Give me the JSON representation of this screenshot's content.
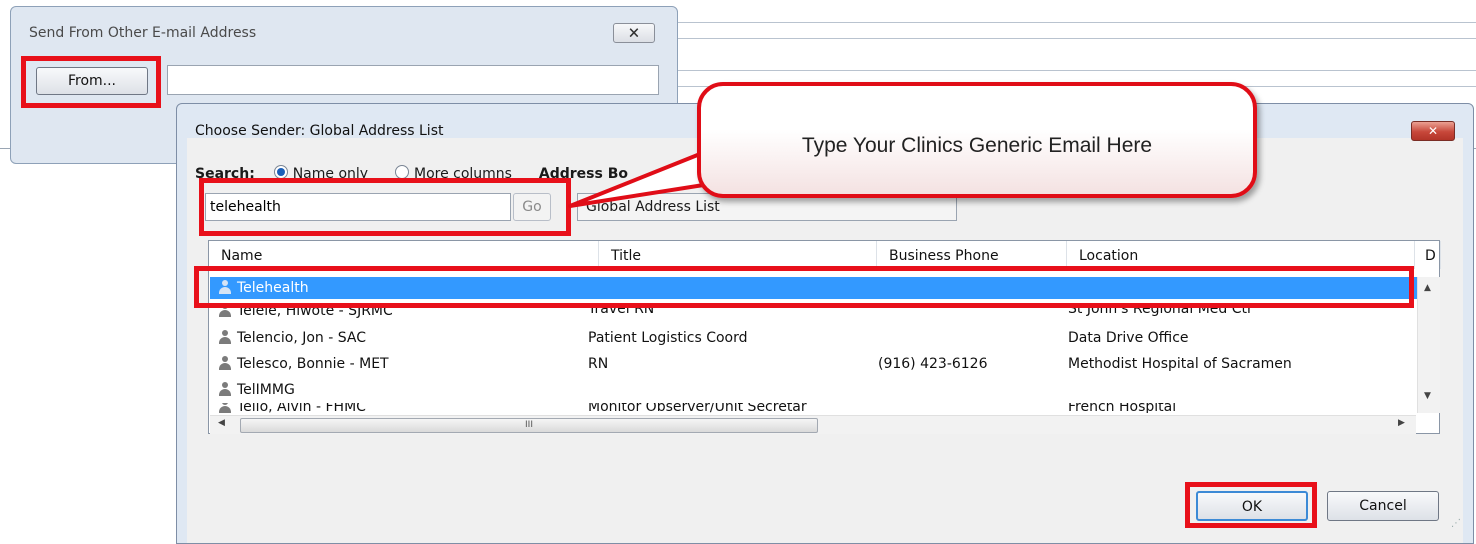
{
  "dialog_from": {
    "title": "Send From Other E-mail Address",
    "close_label": "🗙",
    "from_button": "From...",
    "from_value": ""
  },
  "dialog_choose": {
    "title": "Choose Sender: Global Address List",
    "close_label": "✕",
    "search_label": "Search:",
    "option_name_only": "Name only",
    "option_more_columns": "More columns",
    "address_book_label": "Address Bo",
    "search_value": "telehealth",
    "go_button": "Go",
    "address_book_value": "Global Address List",
    "columns": [
      "Name",
      "Title",
      "Business Phone",
      "Location",
      "D"
    ],
    "rows": [
      {
        "name": "Telehealth",
        "title": "",
        "phone": "",
        "location": "",
        "selected": true
      },
      {
        "name": "Telele, Hiwote - SJRMC",
        "title": "Travel RN",
        "phone": "",
        "location": "St John's Regional Med Ctr"
      },
      {
        "name": "Telencio, Jon - SAC",
        "title": "Patient Logistics Coord",
        "phone": "",
        "location": "Data Drive Office"
      },
      {
        "name": "Telesco, Bonnie - MET",
        "title": "RN",
        "phone": "(916) 423-6126",
        "location": "Methodist Hospital of Sacramen"
      },
      {
        "name": "TelIMMG",
        "title": "",
        "phone": "",
        "location": ""
      },
      {
        "name": "Tello, Alvin - FHMC",
        "title": "Monitor Observer/Unit Secretar",
        "phone": "",
        "location": "French Hospital"
      }
    ],
    "hscroll_grip": "III",
    "ok_button": "OK",
    "cancel_button": "Cancel"
  },
  "callout": {
    "text": "Type Your Clinics Generic Email Here"
  },
  "colors": {
    "highlight_red": "#e8101a",
    "selection_blue": "#3399ff",
    "dialog_bg": "#dfe7f1"
  }
}
